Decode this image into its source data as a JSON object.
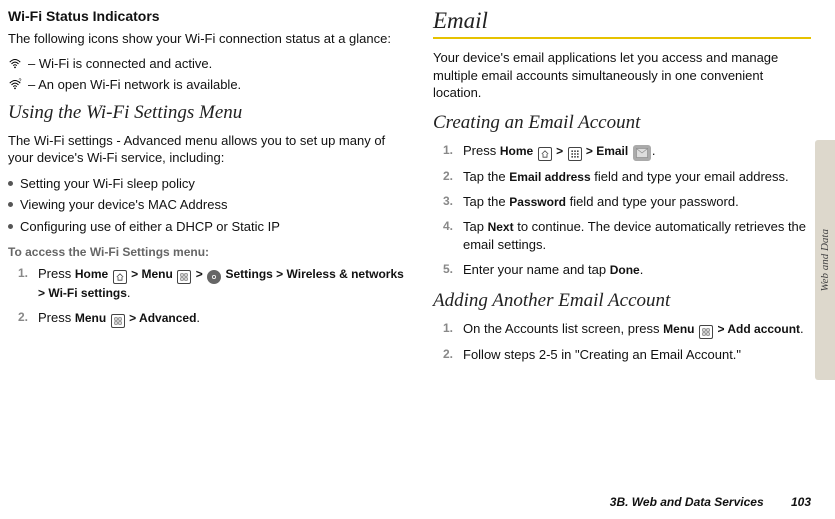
{
  "left": {
    "h_status": "Wi-Fi Status Indicators",
    "p_status": "The following icons show your Wi-Fi connection status at a glance:",
    "icon1_desc": " – Wi-Fi is connected and active.",
    "icon2_desc": " – An open Wi-Fi network is available.",
    "h_settings": "Using the Wi-Fi Settings Menu",
    "p_settings": "The Wi-Fi settings - Advanced menu allows you to set up many of your device's Wi-Fi service, including:",
    "bullets": [
      "Setting your Wi-Fi sleep policy",
      "Viewing your device's MAC Address",
      "Configuring use of either a DHCP or Static IP"
    ],
    "h_access": "To access the Wi-Fi Settings menu:",
    "step1_pre": "Press ",
    "step1_home": "Home",
    "step1_gt1": " > ",
    "step1_menu": "Menu",
    "step1_gt2": " > ",
    "step1_settings": " Settings",
    "step1_gt3": " > ",
    "step1_wireless": "Wireless & networks",
    "step1_gt4": " > ",
    "step1_wifi": "Wi-Fi settings",
    "step1_dot": ".",
    "step2_pre": "Press ",
    "step2_menu": "Menu",
    "step2_gt": " > ",
    "step2_adv": "Advanced",
    "step2_dot": "."
  },
  "right": {
    "h_email": "Email",
    "p_email": "Your device's email applications let you access and manage multiple email accounts simultaneously in one convenient location.",
    "h_create": "Creating an Email Account",
    "c1_pre": "Press ",
    "c1_home": "Home",
    "c1_gt1": " > ",
    "c1_gt2": " > ",
    "c1_emailtxt": "Email",
    "c1_dot": ".",
    "c2_pre": "Tap the ",
    "c2_field": "Email address",
    "c2_post": " field and type your email address.",
    "c3_pre": "Tap the ",
    "c3_field": "Password",
    "c3_post": " field and type your password.",
    "c4_pre": "Tap ",
    "c4_next": "Next",
    "c4_post": " to continue. The device automatically retrieves the email settings.",
    "c5_pre": "Enter your name and tap ",
    "c5_done": "Done",
    "c5_dot": ".",
    "h_add": "Adding Another Email Account",
    "a1_pre": "On the Accounts list screen, press ",
    "a1_menu": "Menu",
    "a1_gt": " > ",
    "a1_add": "Add account",
    "a1_dot": ".",
    "a2": "Follow steps 2-5 in \"Creating an Email Account.\""
  },
  "footer": {
    "title": "3B. Web and Data Services",
    "page": "103"
  },
  "tab": "Web and Data",
  "nums": {
    "n1": "1.",
    "n2": "2.",
    "n3": "3.",
    "n4": "4.",
    "n5": "5."
  }
}
